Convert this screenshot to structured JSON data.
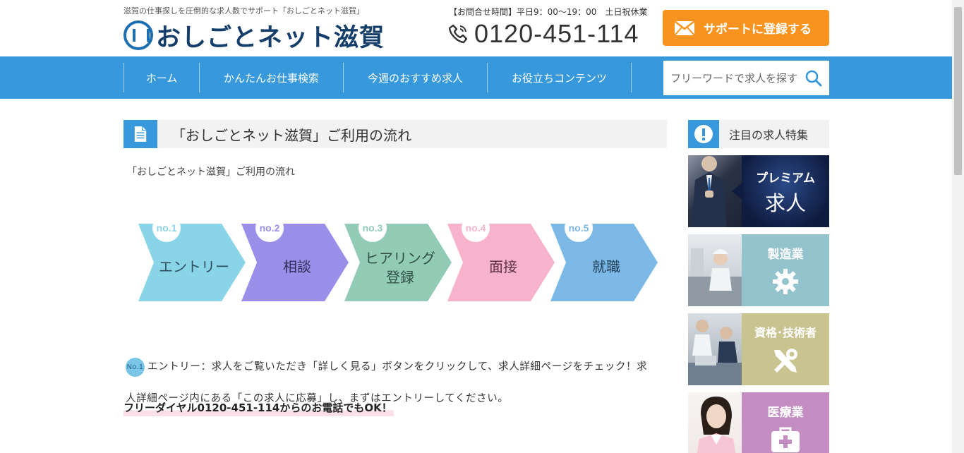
{
  "header": {
    "tagline": "滋賀の仕事探しを圧倒的な求人数でサポート「おしごとネット滋賀」",
    "logo_text": "おしごとネット滋賀",
    "hours": "【お問合せ時間】平日9：00〜19：00　土日祝休業",
    "phone": "0120-451-114",
    "cta_label": "サポートに登録する"
  },
  "nav": {
    "items": [
      "ホーム",
      "かんたんお仕事検索",
      "今週のおすすめ求人",
      "お役立ちコンテンツ"
    ],
    "search_placeholder": "フリーワードで求人を探す"
  },
  "main": {
    "title": "「おしごとネット滋賀」ご利用の流れ",
    "subtitle": "「おしごとネット滋賀」ご利用の流れ",
    "steps": [
      {
        "no": "no.1",
        "label": "エントリー",
        "color": "#8ad4e8",
        "text_color": "#2f4f5f"
      },
      {
        "no": "no.2",
        "label": "相談",
        "color": "#9a8fe8",
        "text_color": "#2f2f5a"
      },
      {
        "no": "no.3",
        "label": "ヒアリング\n登録",
        "color": "#93ccb6",
        "text_color": "#2f4f44"
      },
      {
        "no": "no.4",
        "label": "面接",
        "color": "#f7b3cc",
        "text_color": "#5a2f3f"
      },
      {
        "no": "no.5",
        "label": "就職",
        "color": "#7cb9e6",
        "text_color": "#22405a"
      }
    ],
    "step1_badge": "No.1",
    "step1_text": "エントリー：求人をご覧いただき「詳しく見る」ボタンをクリックして、求人詳細ページをチェック！求人詳細ページ内にある「この求人に応募」し、まずはエントリーしてください。",
    "free_dial": "フリーダイヤル0120-451-114からのお電話でもOK！"
  },
  "sidebar": {
    "heading": "注目の求人特集",
    "banners": [
      {
        "label": "プレミアム",
        "label2": "求人",
        "icon": "none",
        "color": "#0f1c3f"
      },
      {
        "label": "製造業",
        "icon": "gear-icon",
        "color": "#93c3cc"
      },
      {
        "label": "資格･技術者",
        "icon": "tools-icon",
        "color": "#c9c48f"
      },
      {
        "label": "医療業",
        "icon": "medical-bag-icon",
        "color": "#c38dc2"
      }
    ]
  },
  "colors": {
    "nav_blue": "#3799db",
    "cta_orange": "#f7931e",
    "logo_navy": "#153e6b"
  }
}
